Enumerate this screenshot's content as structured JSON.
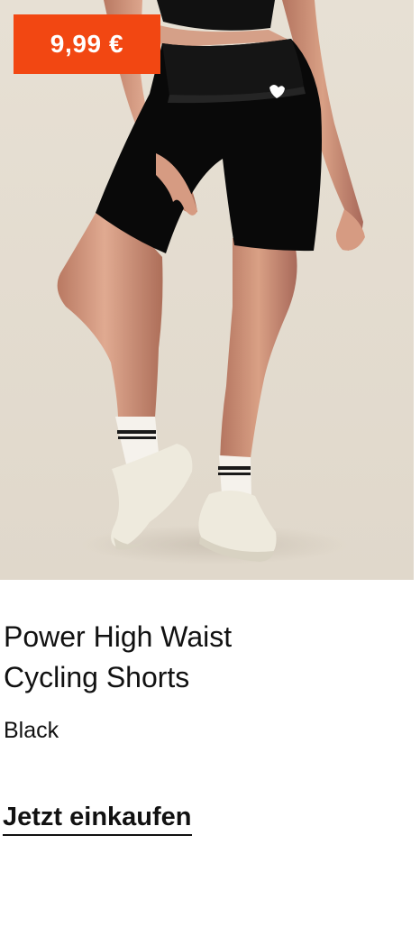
{
  "product": {
    "price": "9,99 €",
    "title": "Power High Waist\nCycling Shorts",
    "color": "Black",
    "cta_label": "Jetzt einkaufen"
  },
  "style": {
    "price_badge_color": "#f24712",
    "image_background": "#e4ddd1",
    "product_color": "#090909"
  },
  "image": {
    "subject": "model wearing black high-waist cycling shorts, white socks and white training shoes"
  }
}
